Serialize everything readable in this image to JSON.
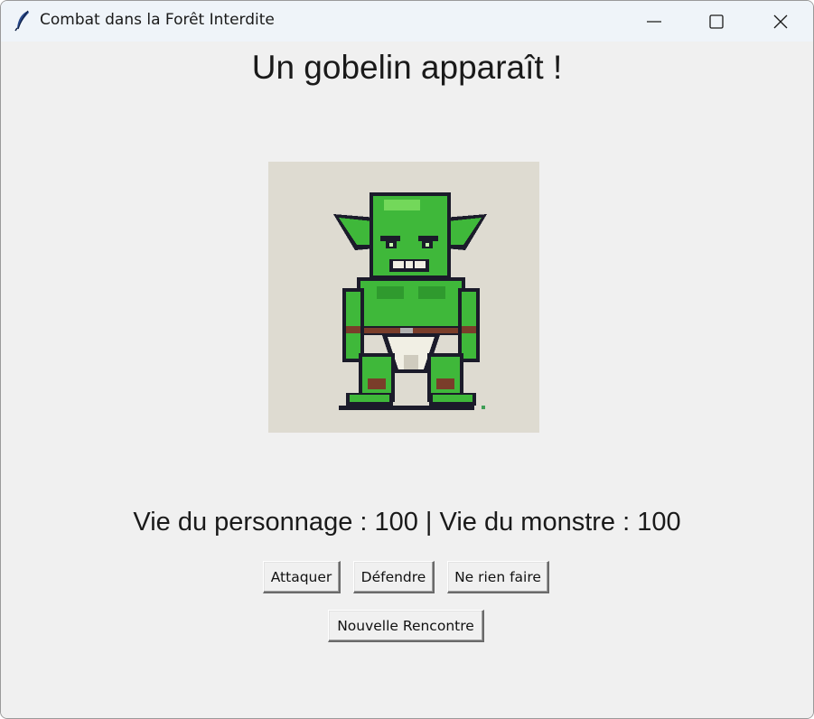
{
  "window": {
    "title": "Combat dans la Forêt Interdite",
    "controls": {
      "minimize": "minimize-icon",
      "maximize": "maximize-icon",
      "close": "close-icon"
    }
  },
  "main": {
    "heading": "Un gobelin apparaît !",
    "monster_image": "goblin-image",
    "status": "Vie du personnage : 100 | Vie du monstre : 100",
    "actions": [
      {
        "label": "Attaquer"
      },
      {
        "label": "Défendre"
      },
      {
        "label": "Ne rien faire"
      }
    ],
    "new_encounter_label": "Nouvelle Rencontre"
  },
  "stats": {
    "character_health": 100,
    "monster_health": 100
  },
  "colors": {
    "window_bg": "#f0f0f0",
    "titlebar_bg": "#eff4f9",
    "portrait_bg": "#dedbd1",
    "goblin_skin": "#3fb83a",
    "goblin_outline": "#1b1b2a"
  }
}
